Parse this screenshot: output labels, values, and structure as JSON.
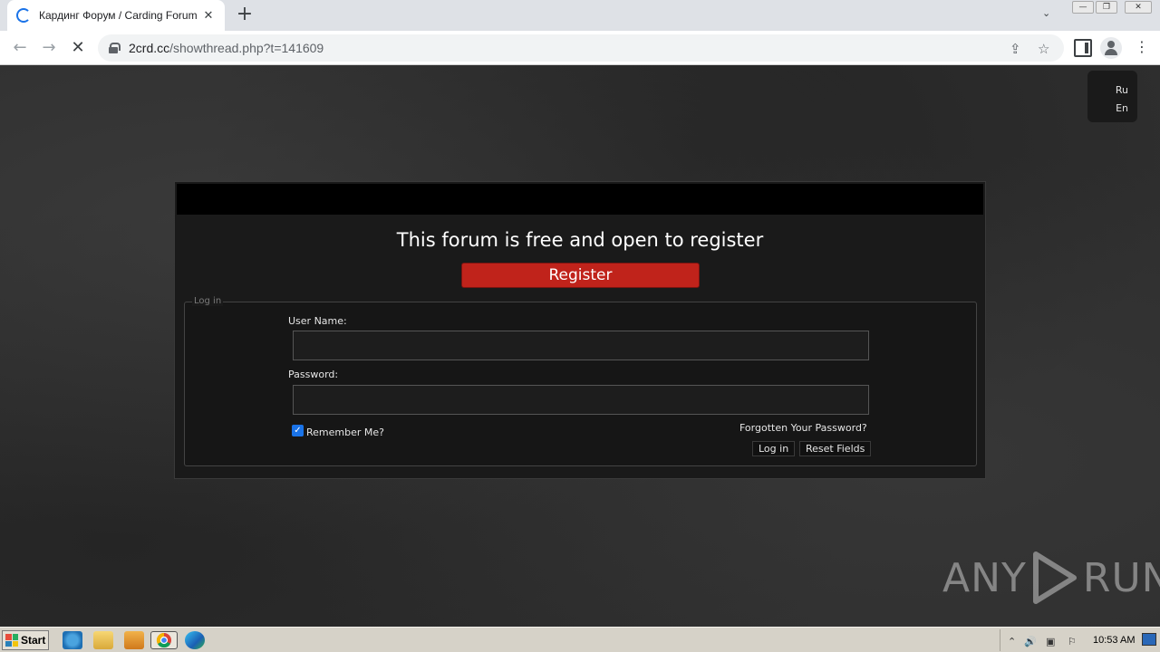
{
  "browser": {
    "tab_title": "Кардинг Форум / Carding Forum",
    "tab_close": "✕",
    "new_tab": "+",
    "tab_search": "⌄",
    "window_controls": [
      "—",
      "❐",
      "✕"
    ],
    "nav": {
      "back": "←",
      "forward": "→",
      "reload": "✕"
    },
    "url_host": "2crd.cc",
    "url_path": "/showthread.php?t=141609",
    "share_icon": "⇪",
    "star_icon": "☆",
    "menu_icon": "⋮"
  },
  "page": {
    "languages": [
      "Ru",
      "En"
    ],
    "headline": "This forum is free and open to register",
    "register_label": "Register",
    "login": {
      "legend": "Log in",
      "username_label": "User Name:",
      "password_label": "Password:",
      "username_value": "",
      "password_value": "",
      "remember_label": "Remember Me?",
      "remember_checked": true,
      "checkmark": "✓",
      "forgot_label": "Forgotten Your Password?",
      "login_button": "Log in",
      "reset_button": "Reset Fields"
    }
  },
  "watermark": {
    "left": "ANY",
    "right": "RUN"
  },
  "taskbar": {
    "start_label": "Start",
    "clock": "10:53 AM",
    "tray_icons": [
      "⌃",
      "🔊",
      "▣",
      "⚐"
    ]
  },
  "colors": {
    "register": "#c0231b",
    "page_bg": "#2e2e2e",
    "panel_bg": "#1a1a1a"
  }
}
